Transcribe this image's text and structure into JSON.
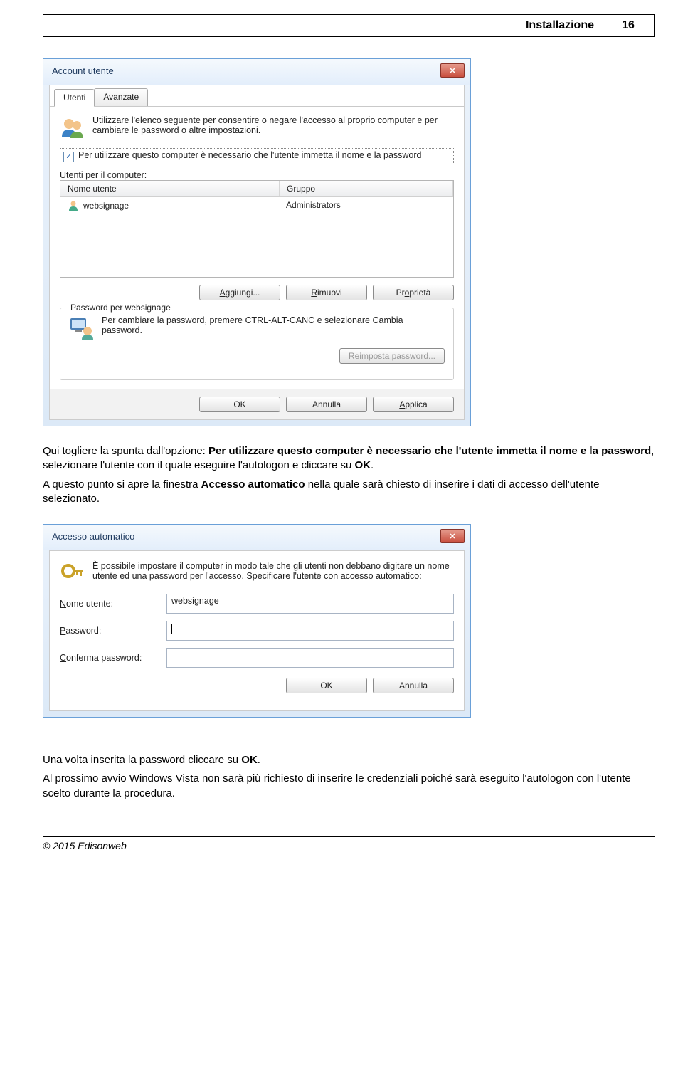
{
  "header": {
    "title": "Installazione",
    "page": "16"
  },
  "dialog1": {
    "title": "Account utente",
    "tab_users": "Utenti",
    "tab_advanced": "Avanzate",
    "intro": "Utilizzare l'elenco seguente per consentire o negare l'accesso al proprio computer e per cambiare le password o altre impostazioni.",
    "checkbox_label": "Per utilizzare questo computer è necessario che l'utente immetta il nome e la password",
    "users_for_computer": "Utenti per il computer:",
    "col_name": "Nome utente",
    "col_group": "Gruppo",
    "row_user": "websignage",
    "row_group": "Administrators",
    "btn_add": "Aggiungi...",
    "btn_remove": "Rimuovi",
    "btn_props": "Proprietà",
    "groupbox_title": "Password per websignage",
    "groupbox_text": "Per cambiare la password, premere CTRL-ALT-CANC e selezionare Cambia password.",
    "btn_reset": "Reimposta password...",
    "btn_ok": "OK",
    "btn_cancel": "Annulla",
    "btn_apply": "Applica"
  },
  "para1_a": "Qui togliere la spunta dall'opzione: ",
  "para1_b": "Per utilizzare questo computer è necessario che l'utente immetta il nome e la password",
  "para1_c": ", selezionare l'utente con il quale eseguire l'autologon e cliccare su ",
  "para1_d": "OK",
  "para1_e": ".",
  "para2_a": "A questo punto si apre la finestra ",
  "para2_b": "Accesso automatico",
  "para2_c": " nella quale sarà chiesto di inserire i dati di accesso dell'utente selezionato.",
  "dialog2": {
    "title": "Accesso automatico",
    "intro": "È possibile impostare il computer in modo tale che gli utenti non debbano digitare un nome utente ed una password per l'accesso. Specificare l'utente con accesso automatico:",
    "lbl_user": "Nome utente:",
    "val_user": "websignage",
    "lbl_pass": "Password:",
    "lbl_confirm": "Conferma password:",
    "btn_ok": "OK",
    "btn_cancel": "Annulla"
  },
  "para3_a": "Una volta inserita la password cliccare su ",
  "para3_b": "OK",
  "para3_c": ".",
  "para4": "Al prossimo avvio Windows Vista non sarà più richiesto di inserire le credenziali poiché sarà eseguito l'autologon con l'utente scelto durante la procedura.",
  "footer": "© 2015 Edisonweb"
}
